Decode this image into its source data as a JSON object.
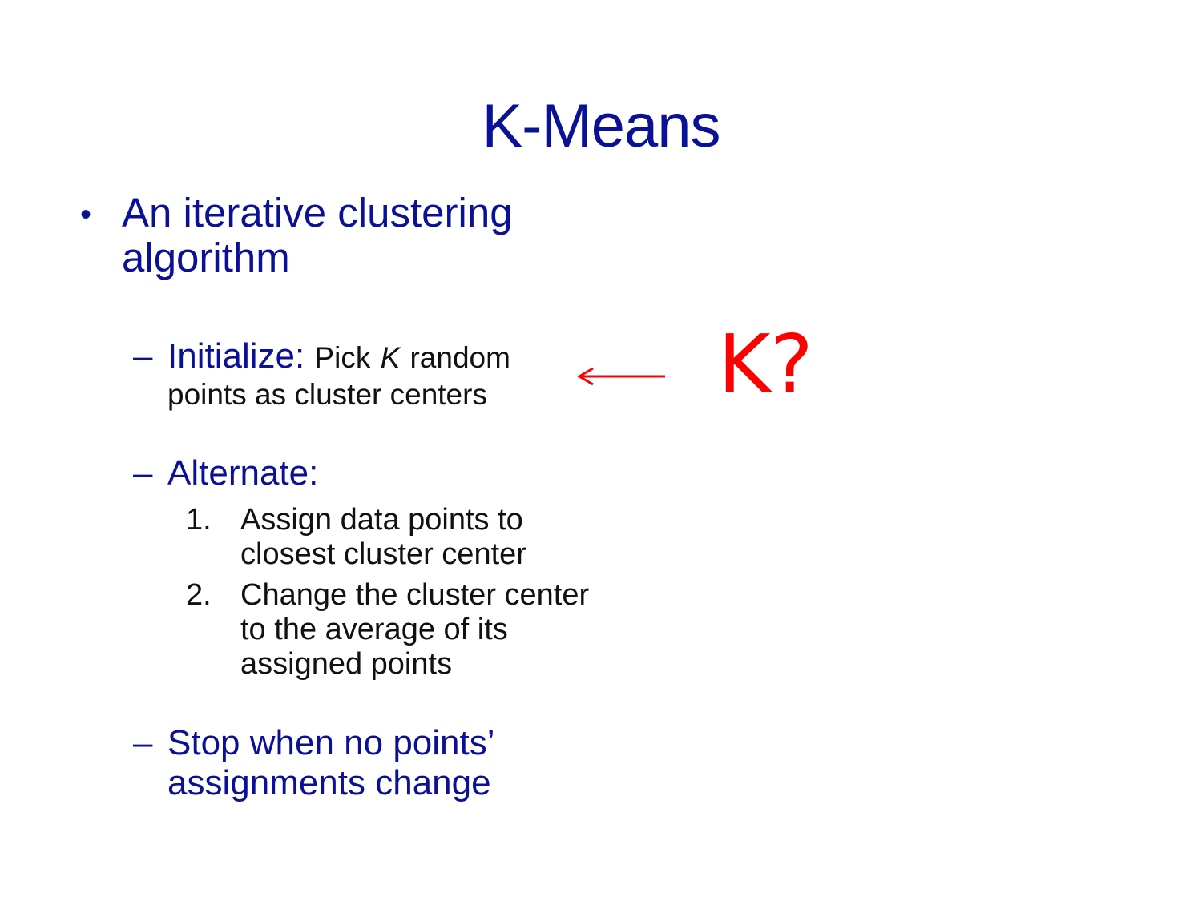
{
  "slide": {
    "title": "K-Means",
    "bullet": "An iterative clustering algorithm",
    "initialize": {
      "label": "Initialize:",
      "text_before_k": "Pick",
      "k": "K",
      "text_after_k": "random",
      "line2": "points as cluster centers"
    },
    "alternate": {
      "label": "Alternate:",
      "steps": [
        {
          "num": "1.",
          "text": "Assign data points to closest cluster center"
        },
        {
          "num": "2.",
          "text": "Change the cluster center to the average of its assigned points"
        }
      ]
    },
    "stop": "Stop when no points’ assignments change",
    "annotation": {
      "text": "K?",
      "color": "#ff0000"
    },
    "colors": {
      "title": "#0a1196",
      "body": "#111111",
      "annotation": "#ff0000"
    }
  }
}
